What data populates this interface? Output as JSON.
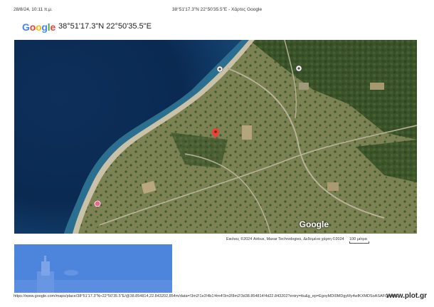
{
  "header": {
    "print_date": "28/8/24, 10:11 π.μ.",
    "print_title": "38°51'17.3\"N 22°50'35.5\"E - Χάρτες Google"
  },
  "logo": {
    "letters": [
      "G",
      "o",
      "o",
      "g",
      "l",
      "e"
    ],
    "colors": [
      "#4285F4",
      "#EA4335",
      "#FBBC05",
      "#4285F4",
      "#34A853",
      "#EA4335"
    ]
  },
  "location": {
    "coordinates": "38°51'17.3\"N 22°50'35.5\"E",
    "pin_color": "#EA4335"
  },
  "map": {
    "view": "satellite",
    "watermark": "Google",
    "attribution": "Εικόνες ©2024 Airbus, Maxar Technologies, Δεδομένα χάρτη ©2024",
    "scale_label": "100 μέτρα"
  },
  "footer": {
    "url": "https://www.google.com/maps/place/38°51'17.3\"N+22°50'35.5\"E/@38.854814,22.843202,854m/data=!3m2!1e3!4b1!4m4!3m3!8m2!3d38.854814!4d22.843202?entry=ttu&g_ep=EgoyMDI0MDgyMy4wIKXMDSoASAFQAw%3D%3D",
    "watermark": "www.plot.gr"
  }
}
